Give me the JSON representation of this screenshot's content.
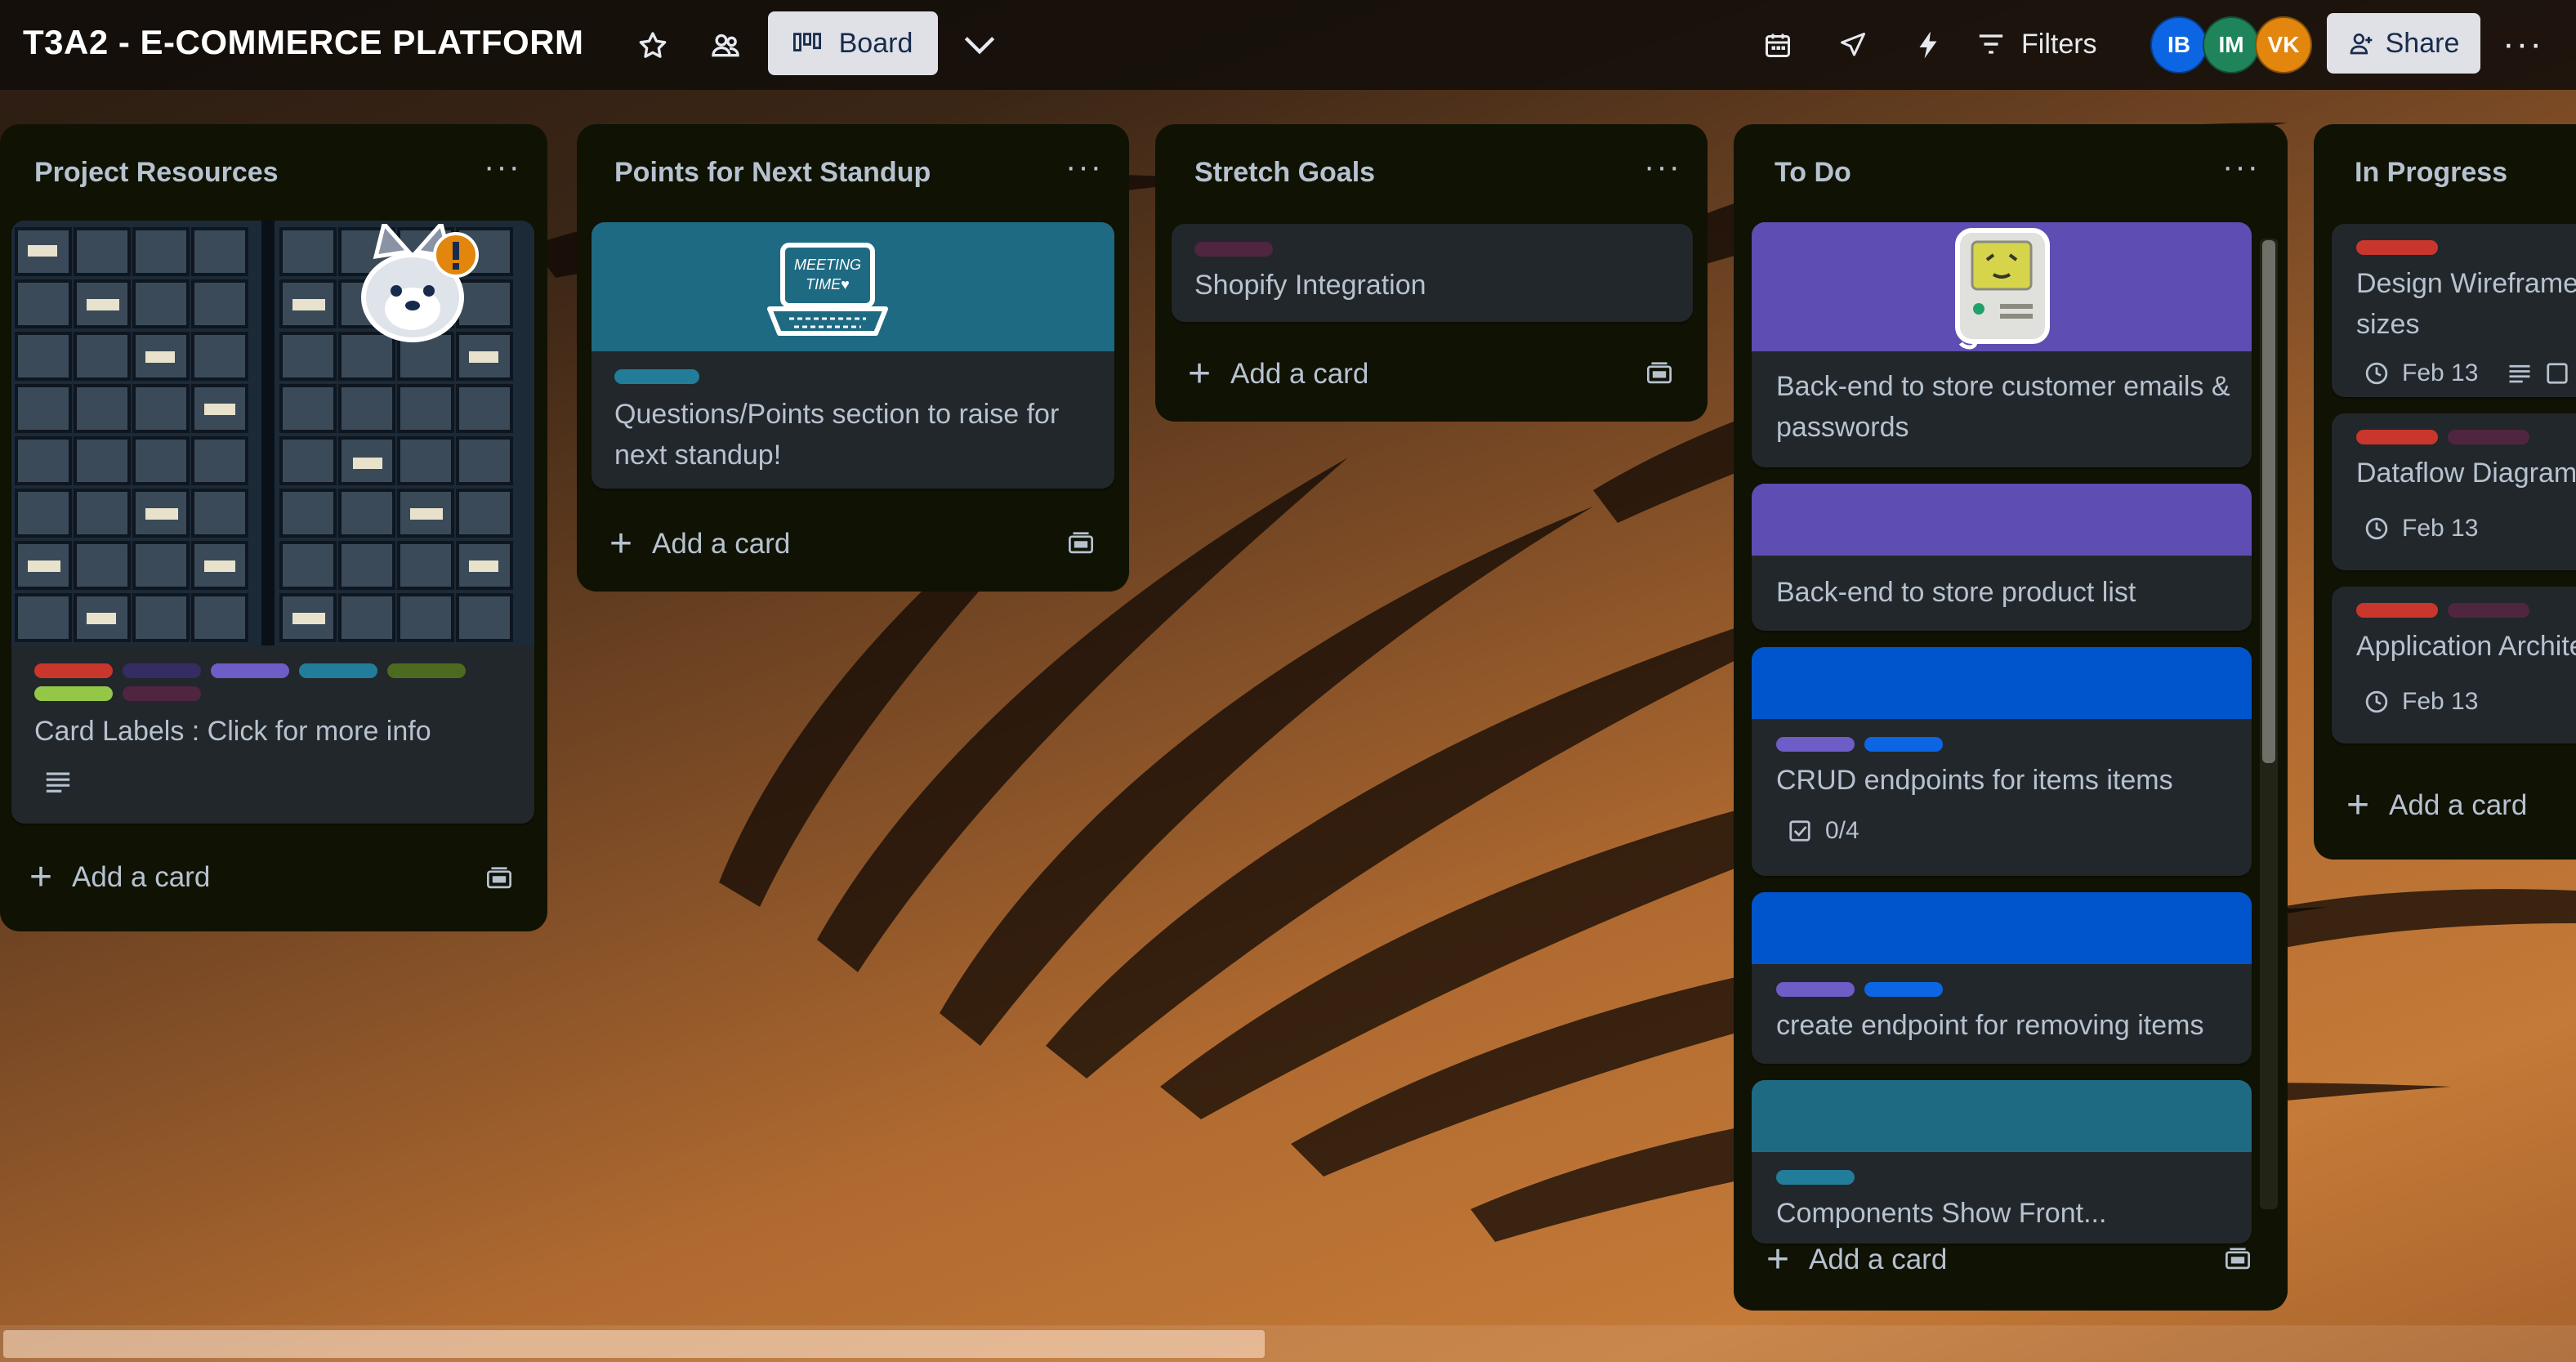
{
  "header": {
    "board_title": "T3A2 - E-COMMERCE PLATFORM",
    "board_view_label": "Board",
    "filters_label": "Filters",
    "share_label": "Share",
    "members": [
      {
        "initials": "IB",
        "color": "#0c66e4"
      },
      {
        "initials": "IM",
        "color": "#1f845a"
      },
      {
        "initials": "VK",
        "color": "#e2860e"
      }
    ]
  },
  "label_colors": {
    "red": "#c9372c",
    "dark_purple": "#352c63",
    "purple": "#6e5dc6",
    "teal": "#227d9b",
    "green": "#4c6b1f",
    "lime": "#94c748",
    "magenta": "#50253f",
    "blue": "#0c66e4"
  },
  "lists": [
    {
      "title": "Project Resources",
      "menu": "···",
      "add_card": "Add a card",
      "cards": [
        {
          "title": "Card Labels : Click for more info",
          "cover": "storage-bins-image",
          "sticker": "alert-dog-sticker",
          "badges": [
            "description-icon"
          ]
        }
      ]
    },
    {
      "title": "Points for Next Standup",
      "menu": "···",
      "add_card": "Add a card",
      "cards": [
        {
          "title": "Questions/Points section to raise for next standup!",
          "cover_color": "#1f6a83",
          "sticker": "meeting-time-laptop-sticker"
        }
      ]
    },
    {
      "title": "Stretch Goals",
      "menu": "···",
      "add_card": "Add a card",
      "cards": [
        {
          "title": "Shopify Integration"
        }
      ]
    },
    {
      "title": "To Do",
      "menu": "···",
      "add_card": "Add a card",
      "cards": [
        {
          "title": "Back-end to store customer emails & passwords",
          "cover_color": "#5e4db2",
          "sticker": "robot-computer-sticker"
        },
        {
          "title": "Back-end to store product list",
          "cover_color": "#5e4db2"
        },
        {
          "title": "CRUD endpoints for items items",
          "cover_color": "#0055cc",
          "checklist": "0/4"
        },
        {
          "title": "create endpoint for removing items",
          "cover_color": "#0055cc"
        },
        {
          "title": "Components Show Front...",
          "cover_color": "#1f6a83"
        }
      ]
    },
    {
      "title": "In Progress",
      "add_card": "Add a card",
      "cards": [
        {
          "title": "Design Wireframe screen sizes",
          "date": "Feb 13"
        },
        {
          "title": "Dataflow Diagram",
          "date": "Feb 13"
        },
        {
          "title": "Application Architecture",
          "date": "Feb 13"
        }
      ]
    }
  ]
}
